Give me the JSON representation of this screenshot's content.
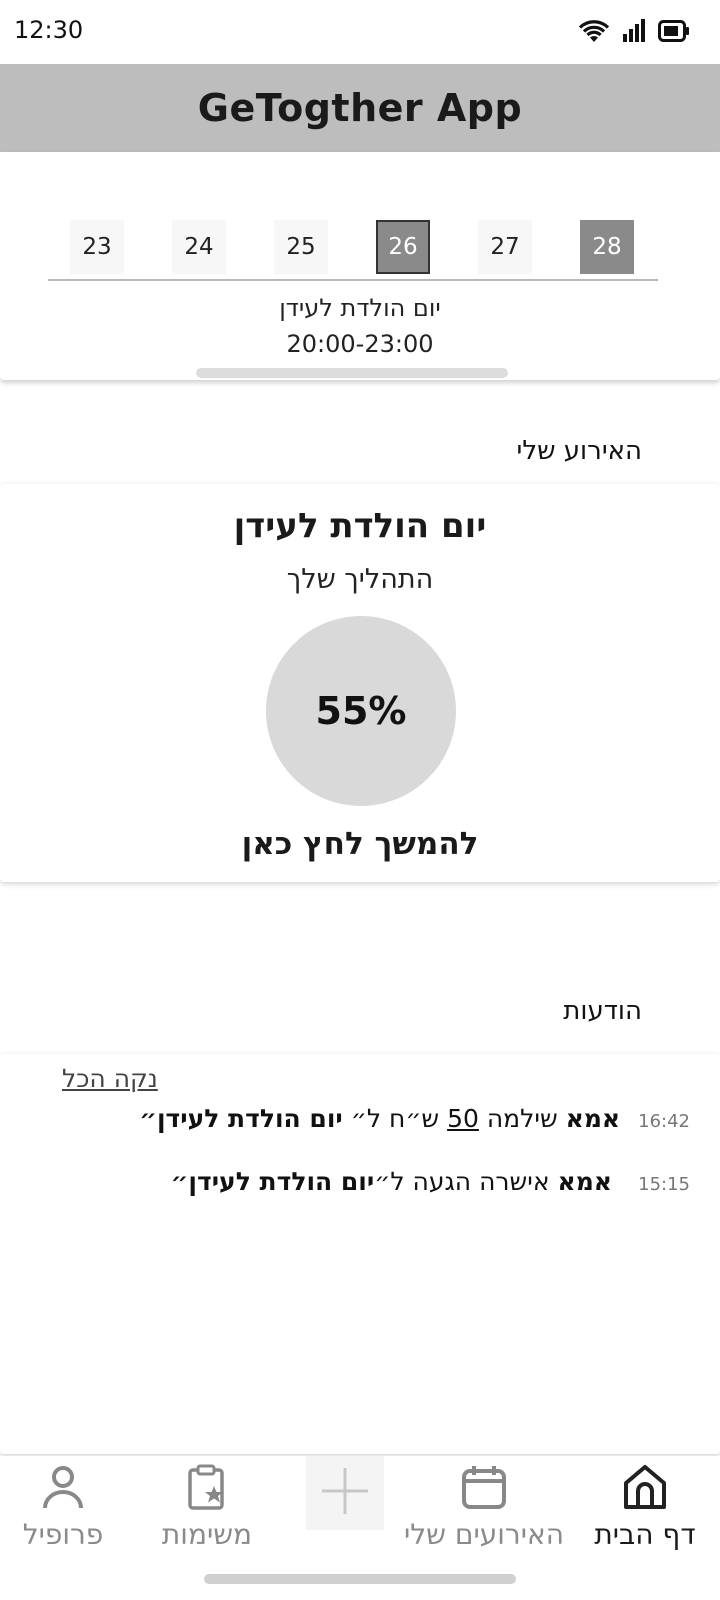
{
  "status_bar": {
    "time": "12:30"
  },
  "app": {
    "title": "GeTogther App"
  },
  "calendar": {
    "days": [
      "23",
      "24",
      "25",
      "26",
      "27",
      "28"
    ],
    "selected_day": "26",
    "marked_day": "28",
    "event_title": "יום הולדת לעידן",
    "event_time": "20:00-23:00"
  },
  "my_event": {
    "heading": "האירוע שלי",
    "name": "יום הולדת לעידן",
    "progress_label": "התהליך שלך",
    "progress_text": "55%",
    "progress_percent": 55,
    "continue_label": "להמשך לחץ כאן"
  },
  "notifications": {
    "heading": "הודעות",
    "clear_all": "נקה הכל",
    "items": [
      {
        "time": "16:42",
        "actor": "אמא",
        "t1": " שילמה ",
        "amount": "50",
        "t2": " ש״ח ל״ ",
        "event": "יום הולדת לעידן",
        "t3": "״"
      },
      {
        "time": "15:15",
        "actor": "אמא",
        "t1": " אישרה הגעה ל״",
        "event": "יום הולדת לעידן",
        "t3": "״"
      }
    ]
  },
  "bottom_nav": {
    "items": [
      {
        "label": "דף הבית",
        "icon": "home-icon",
        "active": true
      },
      {
        "label": "האירועים שלי",
        "icon": "calendar-icon",
        "active": false
      },
      {
        "label": "",
        "icon": "add-icon",
        "active": false
      },
      {
        "label": "משימות",
        "icon": "tasks-clipboard-icon",
        "active": false
      },
      {
        "label": "פרופיל",
        "icon": "profile-icon",
        "active": false
      }
    ]
  },
  "colors": {
    "header_bg": "#bdbdbd",
    "selected_day": "#8a8a8a",
    "progress_circle": "#d9d9d9"
  }
}
